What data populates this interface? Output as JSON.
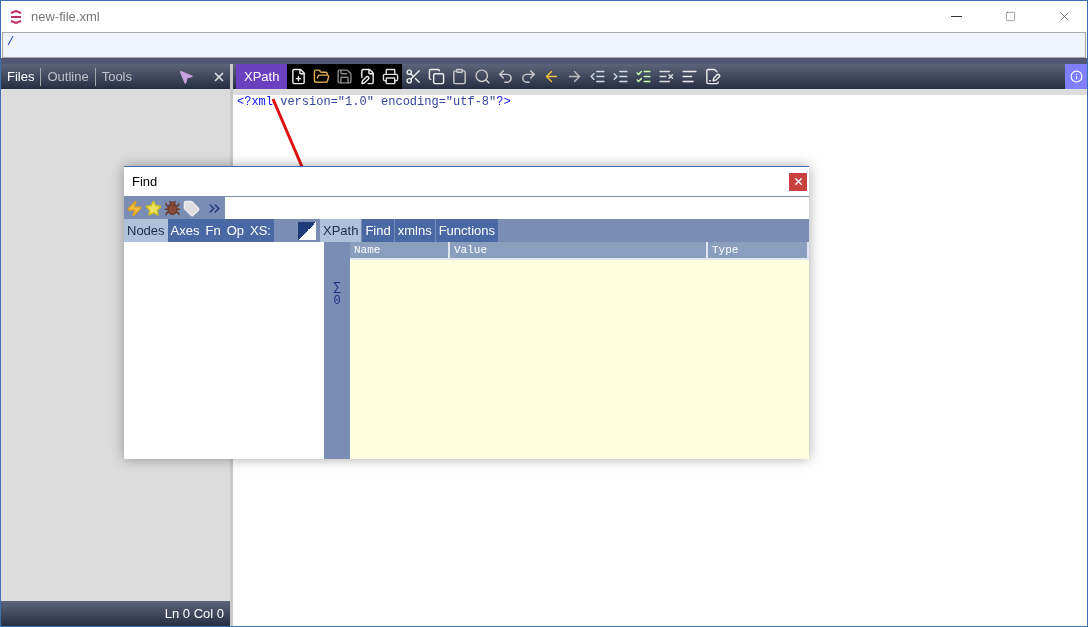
{
  "window": {
    "title": "new-file.xml",
    "path": "/"
  },
  "sidebar": {
    "tabs": [
      {
        "label": "Files",
        "selected": true
      },
      {
        "label": "Outline",
        "selected": false
      },
      {
        "label": "Tools",
        "selected": false
      }
    ],
    "status": "Ln 0 Col 0"
  },
  "editor": {
    "mode_button": "XPath",
    "code": [
      {
        "kind": "mark",
        "text": "<?xml"
      },
      {
        "kind": "plain",
        "text": " version=\"1.0\" encoding=\"utf-8\""
      },
      {
        "kind": "mark",
        "text": "?>"
      }
    ]
  },
  "find_dialog": {
    "title": "Find",
    "left_tabs": [
      {
        "label": "Nodes",
        "selected": true
      },
      {
        "label": "Axes",
        "selected": false
      },
      {
        "label": "Fn",
        "selected": false
      },
      {
        "label": "Op",
        "selected": false
      },
      {
        "label": "XS:",
        "selected": false
      }
    ],
    "right_tabs": [
      {
        "label": "XPath",
        "selected": true
      },
      {
        "label": "Find",
        "selected": false
      },
      {
        "label": "xmlns",
        "selected": false
      },
      {
        "label": "Functions",
        "selected": false
      }
    ],
    "columns": [
      "Name",
      "Value",
      "Type"
    ],
    "sum_symbol": "∑",
    "count": "0"
  }
}
